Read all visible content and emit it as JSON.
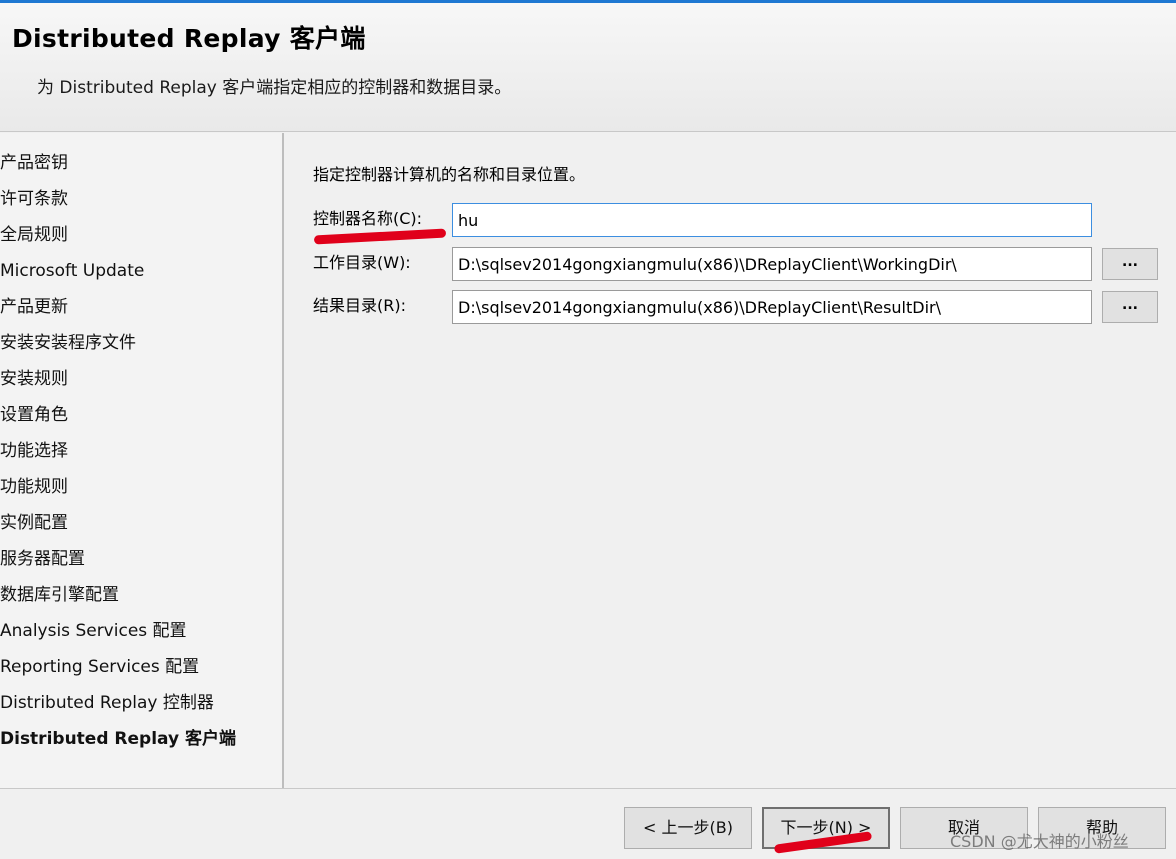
{
  "header": {
    "title": "Distributed  Replay 客户端",
    "subtitle": "为 Distributed Replay 客户端指定相应的控制器和数据目录。"
  },
  "nav": {
    "items": [
      {
        "label": "产品密钥"
      },
      {
        "label": "许可条款"
      },
      {
        "label": "全局规则"
      },
      {
        "label": "Microsoft Update"
      },
      {
        "label": "产品更新"
      },
      {
        "label": "安装安装程序文件"
      },
      {
        "label": "安装规则"
      },
      {
        "label": "设置角色"
      },
      {
        "label": "功能选择"
      },
      {
        "label": "功能规则"
      },
      {
        "label": "实例配置"
      },
      {
        "label": "服务器配置"
      },
      {
        "label": "数据库引擎配置"
      },
      {
        "label": "Analysis Services 配置"
      },
      {
        "label": "Reporting Services 配置"
      },
      {
        "label": "Distributed Replay 控制器"
      },
      {
        "label": "Distributed Replay 客户端"
      }
    ],
    "active_index": 16
  },
  "content": {
    "instruction": "指定控制器计算机的名称和目录位置。",
    "controller": {
      "label": "控制器名称(C):",
      "value": "hu"
    },
    "working_dir": {
      "label": "工作目录(W):",
      "value": "D:\\sqlsev2014gongxiangmulu(x86)\\DReplayClient\\WorkingDir\\",
      "browse_label": "..."
    },
    "result_dir": {
      "label": "结果目录(R):",
      "value": "D:\\sqlsev2014gongxiangmulu(x86)\\DReplayClient\\ResultDir\\",
      "browse_label": "..."
    }
  },
  "footer": {
    "back_label": "< 上一步(B)",
    "next_label": "下一步(N) >",
    "cancel_label": "取消",
    "help_label": "帮助"
  },
  "watermark": "CSDN @尤大神的小粉丝",
  "colors": {
    "accent": "#1e78d2",
    "annotation": "#e0001a"
  }
}
